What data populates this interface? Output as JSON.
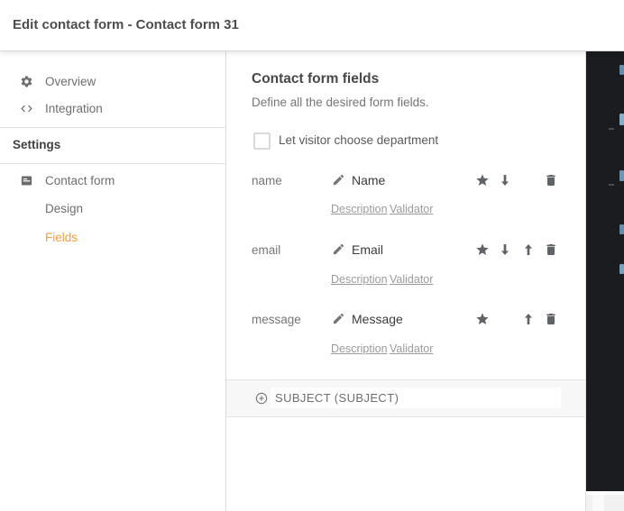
{
  "header": {
    "title": "Edit contact form - Contact form 31"
  },
  "sidebar": {
    "overview": {
      "label": "Overview",
      "icon": "gear-icon"
    },
    "integration": {
      "label": "Integration",
      "icon": "code-icon"
    },
    "settings_header": "Settings",
    "contact_form": {
      "label": "Contact form",
      "icon": "form-icon"
    },
    "design": {
      "label": "Design"
    },
    "fields": {
      "label": "Fields",
      "active": true
    }
  },
  "main": {
    "title": "Contact form fields",
    "subtitle": "Define all the desired form fields.",
    "department_option": {
      "label": "Let visitor choose department",
      "checked": false
    },
    "fields": [
      {
        "key": "name",
        "label": "Name",
        "description_link": "Description",
        "validator_link": "Validator",
        "actions": [
          "favorite",
          "move-down",
          "delete"
        ]
      },
      {
        "key": "email",
        "label": "Email",
        "description_link": "Description",
        "validator_link": "Validator",
        "actions": [
          "favorite",
          "move-down",
          "move-up",
          "delete"
        ]
      },
      {
        "key": "message",
        "label": "Message",
        "description_link": "Description",
        "validator_link": "Validator",
        "actions": [
          "favorite",
          "move-up",
          "delete"
        ]
      }
    ],
    "add_field_row": {
      "label": "SUBJECT (SUBJECT)",
      "icon": "plus-circle-icon"
    }
  },
  "icons": {
    "edit": "pencil-icon",
    "favorite": "star-icon",
    "move_down": "arrow-down-icon",
    "move_up": "arrow-up-icon",
    "delete": "trash-icon"
  },
  "colors": {
    "accent_orange": "#F59E3F",
    "icon_gray": "#5f6368",
    "text_dark": "#3a3a3a",
    "text_muted": "#757575",
    "dark_panel": "#1b1c1f"
  }
}
